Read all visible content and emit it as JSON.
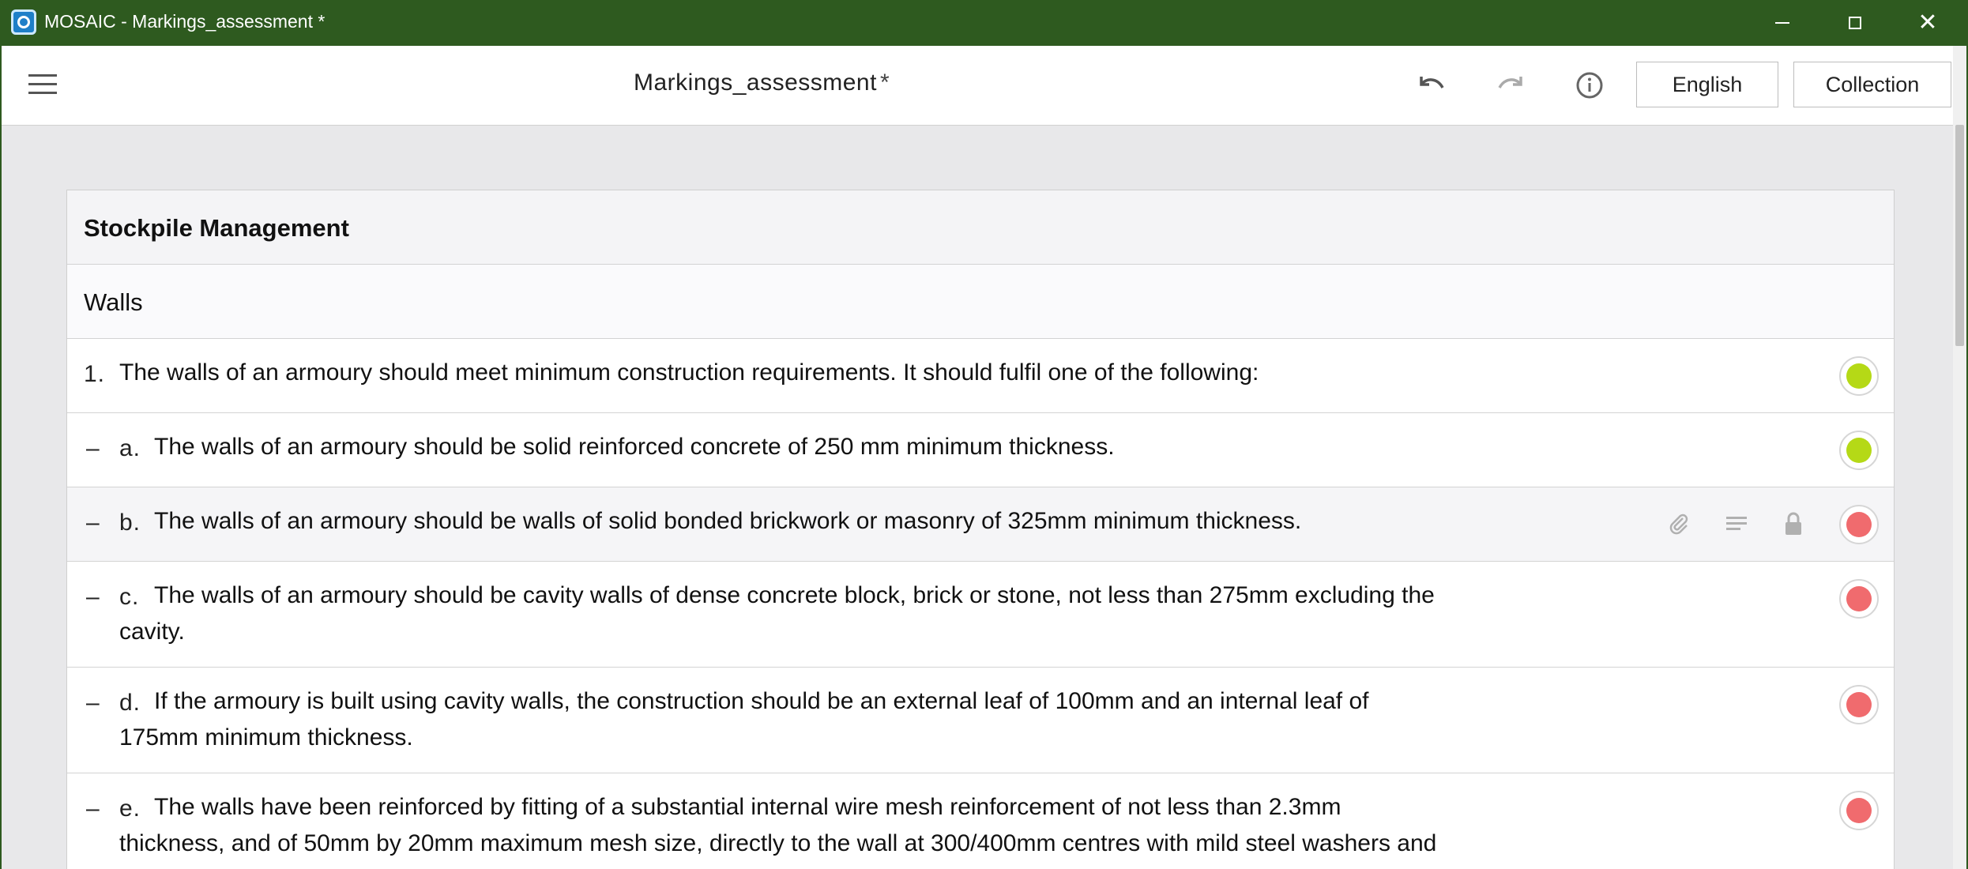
{
  "window": {
    "title": "MOSAIC - Markings_assessment *"
  },
  "toolbar": {
    "doc_title": "Markings_assessment",
    "modified_marker": "*",
    "language_label": "English",
    "collection_label": "Collection"
  },
  "section": {
    "title": "Stockpile Management",
    "subsection": "Walls"
  },
  "items": [
    {
      "num": "1.",
      "text": "The walls of an armoury should meet minimum construction requirements. It should fulfil one of the following:",
      "status_color": "#b5d916"
    },
    {
      "dash": "–",
      "letter": "a.",
      "text": "The walls of an armoury should be solid reinforced concrete of 250 mm minimum thickness.",
      "status_color": "#b5d916"
    },
    {
      "dash": "–",
      "letter": "b.",
      "text": "The walls of an armoury should be walls of solid bonded brickwork or masonry of 325mm minimum thickness.",
      "status_color": "#f06b6e"
    },
    {
      "dash": "–",
      "letter": "c.",
      "text_line1": "The walls of an armoury should be cavity walls of dense concrete block, brick or stone, not less than 275mm excluding the",
      "text_line2": "cavity.",
      "status_color": "#f06b6e"
    },
    {
      "dash": "–",
      "letter": "d.",
      "text_line1": "If the armoury is built using cavity walls, the construction should be an external leaf of 100mm and an internal leaf of",
      "text_line2": "175mm minimum thickness.",
      "status_color": "#f06b6e"
    },
    {
      "dash": "–",
      "letter": "e.",
      "text_line1": "The walls have been reinforced by fitting of a substantial internal wire mesh reinforcement of not less than 2.3mm",
      "text_line2": "thickness, and of 50mm by 20mm maximum mesh size, directly to the wall at 300/400mm centres with mild steel washers and",
      "status_color": "#f06b6e"
    }
  ]
}
